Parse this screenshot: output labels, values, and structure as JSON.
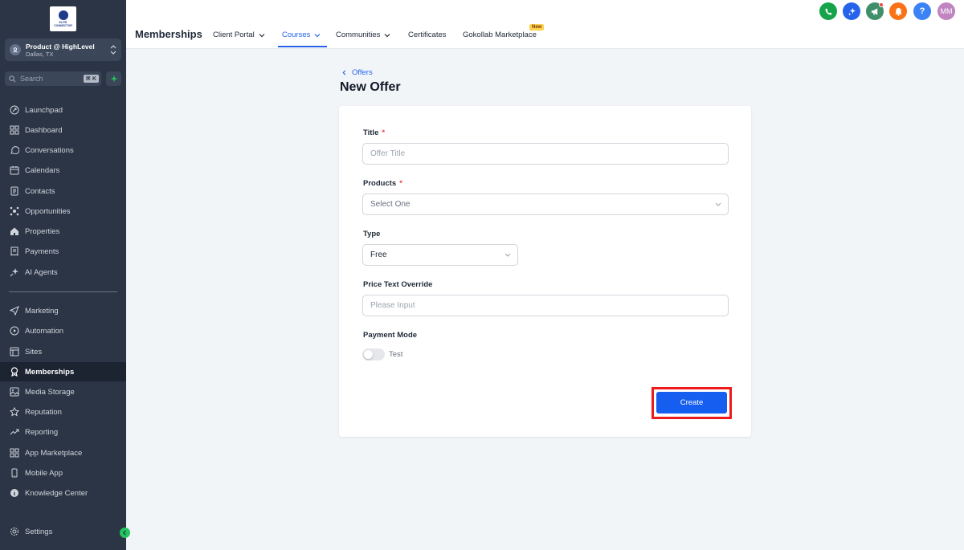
{
  "logo": {
    "text": "ELITE CONNECTOR"
  },
  "account": {
    "name": "Product @ HighLevel",
    "location": "Dallas, TX"
  },
  "search": {
    "placeholder": "Search",
    "shortcut": "⌘ K"
  },
  "sidebar": {
    "items": [
      {
        "label": "Launchpad",
        "icon": "rocket-icon"
      },
      {
        "label": "Dashboard",
        "icon": "grid-icon"
      },
      {
        "label": "Conversations",
        "icon": "chat-icon"
      },
      {
        "label": "Calendars",
        "icon": "calendar-icon"
      },
      {
        "label": "Contacts",
        "icon": "contacts-icon"
      },
      {
        "label": "Opportunities",
        "icon": "opportunities-icon"
      },
      {
        "label": "Properties",
        "icon": "home-icon"
      },
      {
        "label": "Payments",
        "icon": "receipt-icon"
      },
      {
        "label": "AI Agents",
        "icon": "sparkle-icon"
      },
      {
        "label": "Marketing",
        "icon": "send-icon"
      },
      {
        "label": "Automation",
        "icon": "automation-icon"
      },
      {
        "label": "Sites",
        "icon": "sites-icon"
      },
      {
        "label": "Memberships",
        "icon": "award-icon",
        "active": true
      },
      {
        "label": "Media Storage",
        "icon": "image-icon"
      },
      {
        "label": "Reputation",
        "icon": "star-icon"
      },
      {
        "label": "Reporting",
        "icon": "trend-icon"
      },
      {
        "label": "App Marketplace",
        "icon": "apps-icon"
      },
      {
        "label": "Mobile App",
        "icon": "phone-icon"
      },
      {
        "label": "Knowledge Center",
        "icon": "info-icon"
      },
      {
        "label": "Settings",
        "icon": "gear-icon"
      }
    ]
  },
  "header": {
    "title": "Memberships",
    "tabs": [
      {
        "label": "Client Portal"
      },
      {
        "label": "Courses",
        "active": true
      },
      {
        "label": "Communities"
      },
      {
        "label": "Certificates"
      },
      {
        "label": "Gokollab Marketplace",
        "badge": "New"
      }
    ],
    "user_initials": "MM",
    "help_label": "?"
  },
  "page": {
    "back_label": "Offers",
    "title": "New Offer"
  },
  "form": {
    "title_label": "Title",
    "title_placeholder": "Offer Title",
    "required_mark": "*",
    "products_label": "Products",
    "products_value": "Select One",
    "type_label": "Type",
    "type_value": "Free",
    "price_label": "Price Text Override",
    "price_placeholder": "Please Input",
    "payment_label": "Payment Mode",
    "payment_toggle_label": "Test",
    "payment_toggle_on": false,
    "submit_label": "Create"
  },
  "colors": {
    "sidebar_bg": "#2b3546",
    "accent": "#2563eb",
    "button": "#155eef",
    "highlight": "#ef1b1b"
  }
}
